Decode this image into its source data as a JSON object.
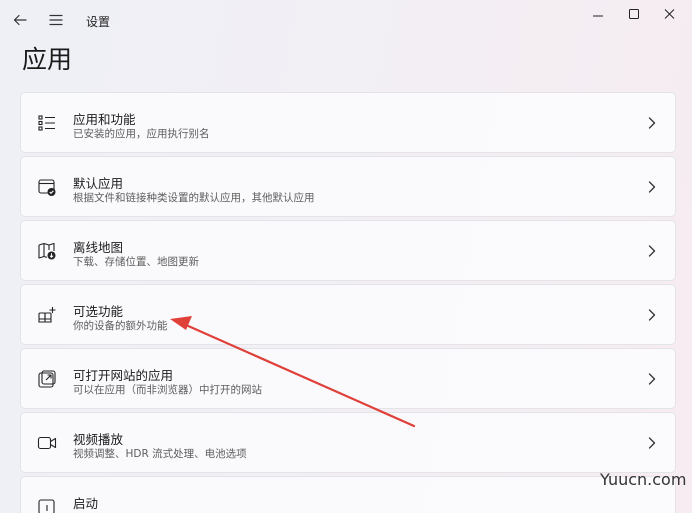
{
  "window": {
    "title": "设置"
  },
  "page": {
    "title": "应用"
  },
  "items": [
    {
      "title": "应用和功能",
      "desc": "已安装的应用，应用执行别名",
      "icon": "apps-list-icon"
    },
    {
      "title": "默认应用",
      "desc": "根据文件和链接种类设置的默认应用，其他默认应用",
      "icon": "default-apps-icon"
    },
    {
      "title": "离线地图",
      "desc": "下载、存储位置、地图更新",
      "icon": "offline-maps-icon"
    },
    {
      "title": "可选功能",
      "desc": "你的设备的额外功能",
      "icon": "optional-features-icon"
    },
    {
      "title": "可打开网站的应用",
      "desc": "可以在应用（而非浏览器）中打开的网站",
      "icon": "apps-for-websites-icon"
    },
    {
      "title": "视频播放",
      "desc": "视频调整、HDR 流式处理、电池选项",
      "icon": "video-playback-icon"
    },
    {
      "title": "启动",
      "desc": "",
      "icon": "startup-icon"
    }
  ],
  "watermark": {
    "text": "Yuucn.com"
  },
  "colors": {
    "annotation_arrow": "#e0403a"
  }
}
